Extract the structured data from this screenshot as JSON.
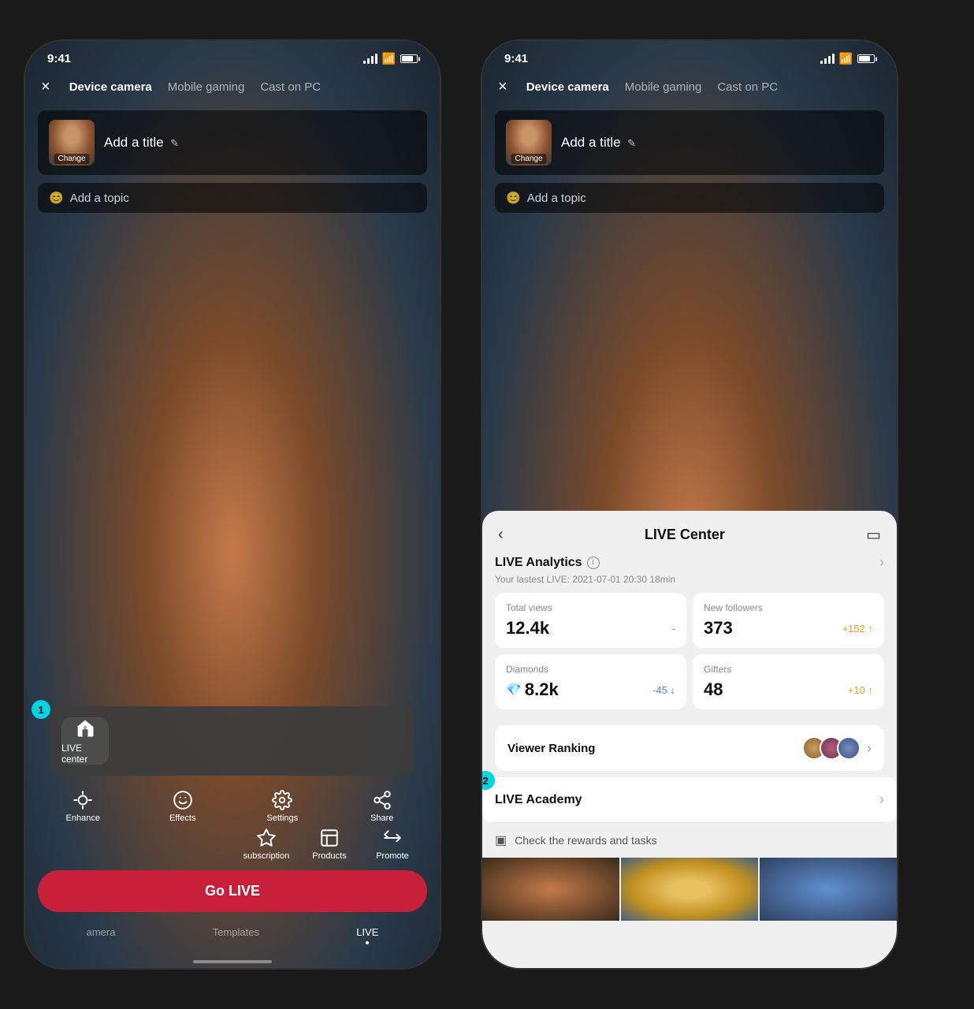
{
  "left_phone": {
    "status_bar": {
      "time": "9:41"
    },
    "nav": {
      "close_label": "×",
      "tabs": [
        "Device camera",
        "Mobile gaming",
        "Cast on PC"
      ],
      "active_tab": "Device camera"
    },
    "title_card": {
      "change_label": "Change",
      "add_title": "Add a title",
      "edit_icon": "✎"
    },
    "topic_row": {
      "emoji": "😊",
      "label": "Add a topic"
    },
    "toolbar": {
      "items": [
        {
          "id": "enhance",
          "label": "Enhance"
        },
        {
          "id": "effects",
          "label": "Effects"
        },
        {
          "id": "settings",
          "label": "Settings"
        },
        {
          "id": "share",
          "label": "Share"
        }
      ],
      "items2": [
        {
          "id": "subscription",
          "label": "subscription"
        },
        {
          "id": "products",
          "label": "Products"
        },
        {
          "id": "promote",
          "label": "Promote"
        }
      ]
    },
    "live_center_popup": {
      "label": "LIVE center",
      "step": "1"
    },
    "go_live": "Go LIVE",
    "bottom_nav": {
      "items": [
        "amera",
        "Templates",
        "LIVE"
      ],
      "active": "LIVE"
    }
  },
  "right_phone": {
    "status_bar": {
      "time": "9:41"
    },
    "nav": {
      "close_label": "×",
      "tabs": [
        "Device camera",
        "Mobile gaming",
        "Cast on PC"
      ],
      "active_tab": "Device camera"
    },
    "title_card": {
      "change_label": "Change",
      "add_title": "Add a title",
      "edit_icon": "✎"
    },
    "topic_row": {
      "emoji": "😊",
      "label": "Add a topic"
    },
    "live_center": {
      "back_label": "‹",
      "title": "LIVE Center",
      "cam_icon": "▭",
      "analytics": {
        "title": "LIVE Analytics",
        "info": "i",
        "subtitle": "Your lastest LIVE: 2021-07-01 20:30 18min",
        "chevron": "›",
        "stats": [
          {
            "label": "Total views",
            "value": "12.4k",
            "change": "-",
            "change_type": "neutral"
          },
          {
            "label": "New followers",
            "value": "373",
            "change": "+152 ↑",
            "change_type": "positive"
          },
          {
            "label": "Diamonds",
            "value": "8.2k",
            "change": "-45 ↓",
            "change_type": "negative",
            "has_diamond": true
          },
          {
            "label": "Gifters",
            "value": "48",
            "change": "+10 ↑",
            "change_type": "positive"
          }
        ]
      },
      "viewer_ranking": "Viewer Ranking",
      "live_academy": {
        "title": "LIVE Academy",
        "chevron": "›",
        "step": "2"
      },
      "rewards": {
        "icon": "▣",
        "label": "Check the rewards and tasks"
      }
    }
  }
}
